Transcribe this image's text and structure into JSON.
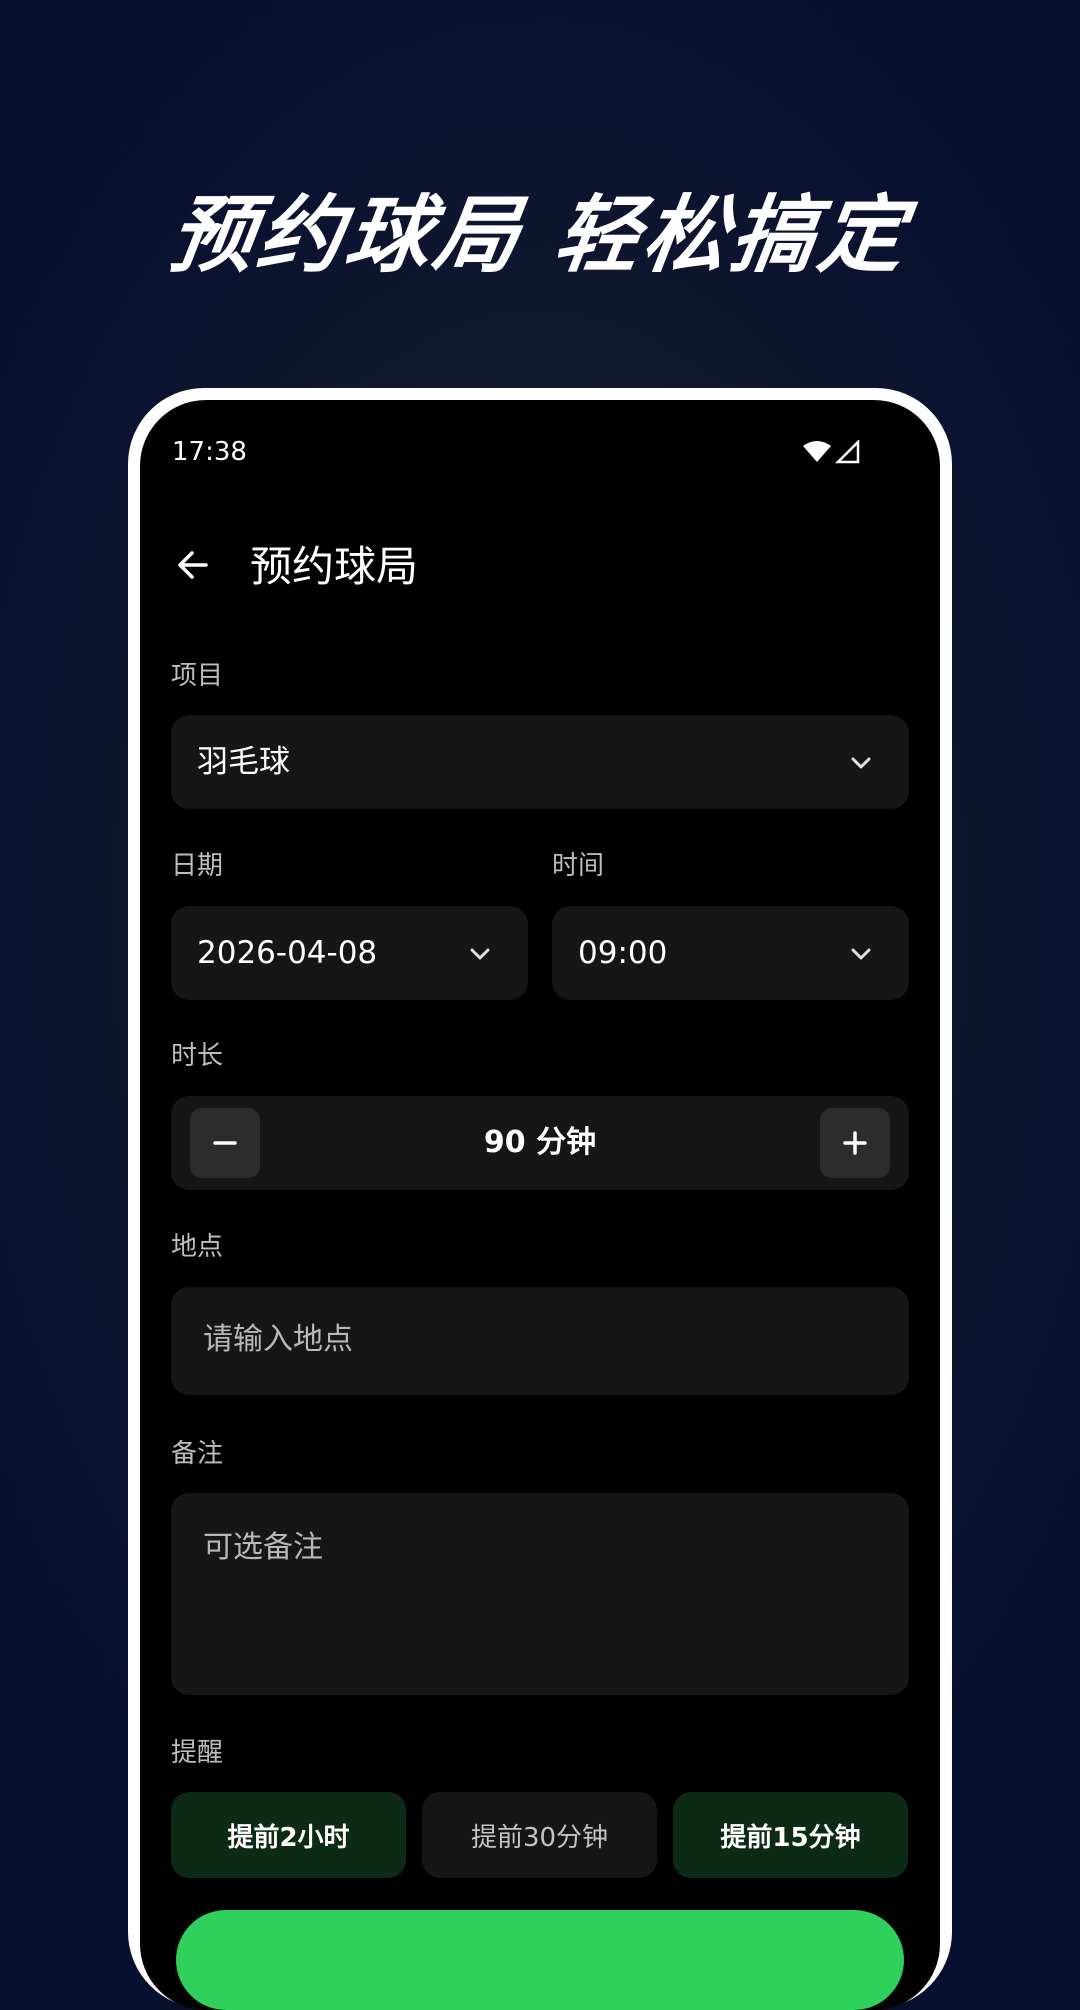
{
  "headline": "预约球局 轻松搞定",
  "status_bar": {
    "time": "17:38",
    "wifi_icon": "wifi-icon",
    "signal_icon": "signal-icon"
  },
  "appbar": {
    "back_icon": "arrow-left-icon",
    "title": "预约球局"
  },
  "form": {
    "sport": {
      "label": "项目",
      "value": "羽毛球"
    },
    "date": {
      "label": "日期",
      "value": "2026-04-08"
    },
    "time": {
      "label": "时间",
      "value": "09:00"
    },
    "duration": {
      "label": "时长",
      "value": "90 分钟",
      "decrease_icon": "minus-icon",
      "increase_icon": "plus-icon"
    },
    "location": {
      "label": "地点",
      "placeholder": "请输入地点"
    },
    "notes": {
      "label": "备注",
      "placeholder": "可选备注"
    },
    "reminder": {
      "label": "提醒",
      "options": [
        {
          "label": "提前2小时",
          "selected": true
        },
        {
          "label": "提前30分钟",
          "selected": false
        },
        {
          "label": "提前15分钟",
          "selected": true
        }
      ]
    }
  },
  "colors": {
    "accent_green": "#2fd15c",
    "chip_selected_bg": "#0d2a17",
    "field_bg": "#161616",
    "screen_bg": "#000000"
  }
}
